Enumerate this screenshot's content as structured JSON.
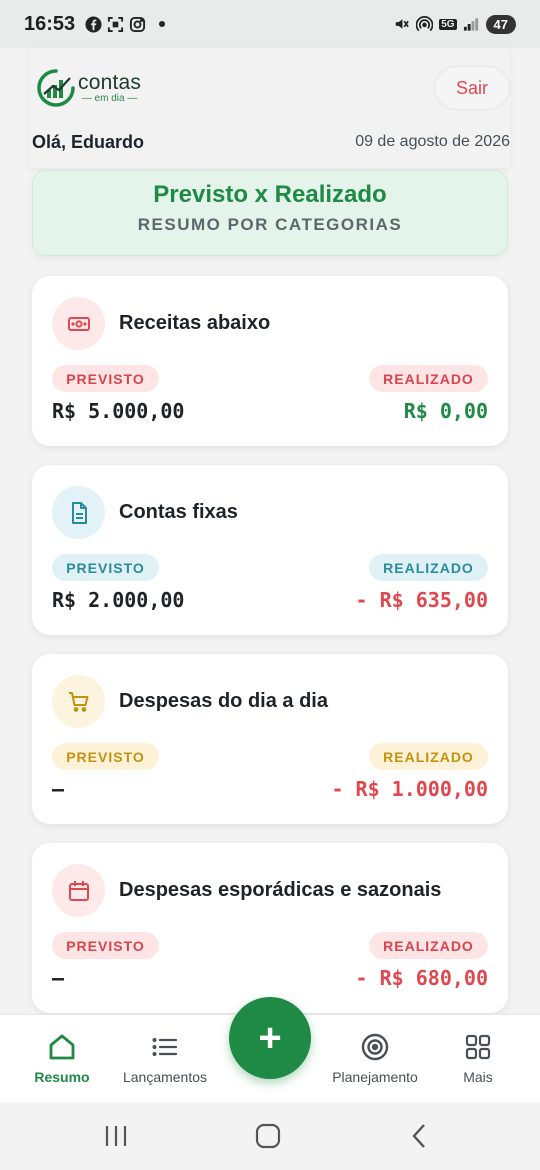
{
  "status_bar": {
    "time": "16:53",
    "battery": "47",
    "network": "5G"
  },
  "header": {
    "logo": {
      "line1": "contas",
      "line2": "em dia"
    },
    "logout_label": "Sair",
    "greeting": "Olá, Eduardo",
    "date": "09 de agosto de 2026"
  },
  "summary": {
    "title": "Previsto x Realizado",
    "subtitle": "RESUMO POR CATEGORIAS"
  },
  "categories": [
    {
      "title": "Receitas abaixo",
      "icon": "money-icon",
      "planned_label": "PREVISTO",
      "actual_label": "REALIZADO",
      "planned": "R$ 5.000,00",
      "actual": "R$ 0,00",
      "color": "#e0484f"
    },
    {
      "title": "Contas fixas",
      "icon": "document-icon",
      "planned_label": "PREVISTO",
      "actual_label": "REALIZADO",
      "planned": "R$ 2.000,00",
      "actual": "- R$ 635,00",
      "color": "#2b8a9c"
    },
    {
      "title": "Despesas do dia a dia",
      "icon": "cart-icon",
      "planned_label": "PREVISTO",
      "actual_label": "REALIZADO",
      "planned": "—",
      "actual": "- R$ 1.000,00",
      "color": "#c4920e"
    },
    {
      "title": "Despesas esporádicas e sazonais",
      "icon": "calendar-icon",
      "planned_label": "PREVISTO",
      "actual_label": "REALIZADO",
      "planned": "—",
      "actual": "- R$ 680,00",
      "color": "#e0484f"
    }
  ],
  "bottom_nav": {
    "items": [
      {
        "label": "Resumo",
        "icon": "home-icon",
        "active": true
      },
      {
        "label": "Lançamentos",
        "icon": "list-icon",
        "active": false
      },
      {
        "label": "Planejamento",
        "icon": "target-icon",
        "active": false
      },
      {
        "label": "Mais",
        "icon": "grid-icon",
        "active": false
      }
    ],
    "fab_label": "+"
  },
  "colors": {
    "brand_green": "#1e8a45",
    "negative_red": "#e0484f"
  }
}
